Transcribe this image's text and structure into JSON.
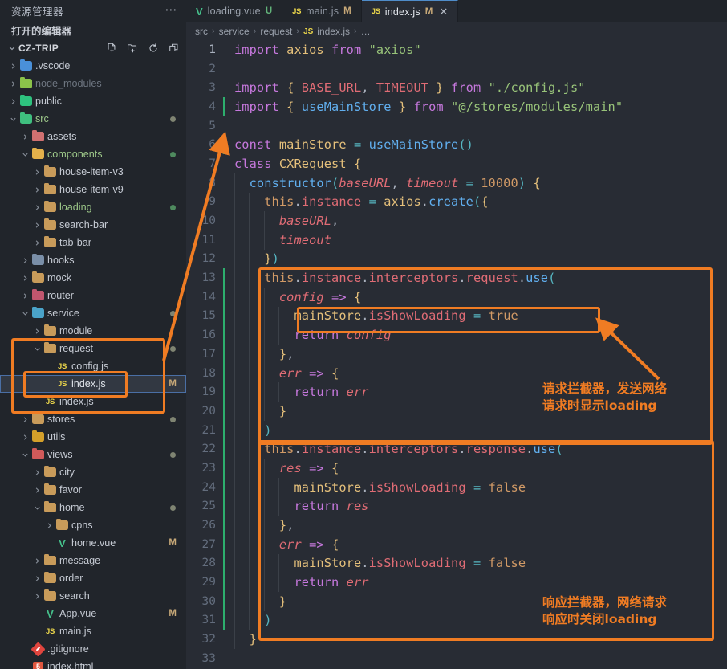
{
  "sidebar": {
    "title": "资源管理器",
    "more_icon": "ellipsis-icon",
    "open_editors_label": "打开的编辑器",
    "project_name": "CZ-TRIP",
    "header_actions": [
      {
        "name": "new-file-icon",
        "label": "新建文件"
      },
      {
        "name": "new-folder-icon",
        "label": "新建文件夹"
      },
      {
        "name": "refresh-icon",
        "label": "刷新"
      },
      {
        "name": "collapse-all-icon",
        "label": "全部折叠"
      }
    ],
    "items": [
      {
        "label": ".vscode",
        "indent": 0,
        "type": "folder",
        "chevron": "right",
        "color": "#4a90d9",
        "badge": "",
        "dot": ""
      },
      {
        "label": "node_modules",
        "indent": 0,
        "type": "folder",
        "chevron": "right",
        "color": "#8bc34a",
        "badge": "",
        "dot": "",
        "dim": true
      },
      {
        "label": "public",
        "indent": 0,
        "type": "folder",
        "chevron": "right",
        "color": "#2ec27e",
        "badge": "",
        "dot": ""
      },
      {
        "label": "src",
        "indent": 0,
        "type": "folder",
        "chevron": "down",
        "color": "#3fbf7f",
        "badge": "",
        "dot": "#7f8472",
        "active": true
      },
      {
        "label": "assets",
        "indent": 1,
        "type": "folder",
        "chevron": "right",
        "color": "#d07070",
        "badge": "",
        "dot": ""
      },
      {
        "label": "components",
        "indent": 1,
        "type": "folder",
        "chevron": "down",
        "color": "#e3b04b",
        "badge": "",
        "dot": "#4e8a5e",
        "active": true
      },
      {
        "label": "house-item-v3",
        "indent": 2,
        "type": "folder",
        "chevron": "right",
        "color": "#c89b5a",
        "badge": "",
        "dot": ""
      },
      {
        "label": "house-item-v9",
        "indent": 2,
        "type": "folder",
        "chevron": "right",
        "color": "#c89b5a",
        "badge": "",
        "dot": ""
      },
      {
        "label": "loading",
        "indent": 2,
        "type": "folder",
        "chevron": "right",
        "color": "#c89b5a",
        "badge": "",
        "dot": "#4e8a5e",
        "active": true
      },
      {
        "label": "search-bar",
        "indent": 2,
        "type": "folder",
        "chevron": "right",
        "color": "#c89b5a",
        "badge": "",
        "dot": ""
      },
      {
        "label": "tab-bar",
        "indent": 2,
        "type": "folder",
        "chevron": "right",
        "color": "#c89b5a",
        "badge": "",
        "dot": ""
      },
      {
        "label": "hooks",
        "indent": 1,
        "type": "folder",
        "chevron": "right",
        "color": "#7a8fa8",
        "badge": "",
        "dot": ""
      },
      {
        "label": "mock",
        "indent": 1,
        "type": "folder",
        "chevron": "right",
        "color": "#c89b5a",
        "badge": "",
        "dot": ""
      },
      {
        "label": "router",
        "indent": 1,
        "type": "folder",
        "chevron": "right",
        "color": "#c0566e",
        "badge": "",
        "dot": ""
      },
      {
        "label": "service",
        "indent": 1,
        "type": "folder",
        "chevron": "down",
        "color": "#4aa3c9",
        "badge": "",
        "dot": "#7f8472"
      },
      {
        "label": "module",
        "indent": 2,
        "type": "folder",
        "chevron": "right",
        "color": "#c89b5a",
        "badge": "",
        "dot": ""
      },
      {
        "label": "request",
        "indent": 2,
        "type": "folder",
        "chevron": "down",
        "color": "#c89b5a",
        "badge": "",
        "dot": "#7f8472"
      },
      {
        "label": "config.js",
        "indent": 3,
        "type": "js",
        "chevron": "none",
        "color": "",
        "badge": "",
        "dot": ""
      },
      {
        "label": "index.js",
        "indent": 3,
        "type": "js",
        "chevron": "none",
        "color": "",
        "badge": "M",
        "dot": "",
        "selected": true
      },
      {
        "label": "index.js",
        "indent": 2,
        "type": "js",
        "chevron": "none",
        "color": "",
        "badge": "",
        "dot": ""
      },
      {
        "label": "stores",
        "indent": 1,
        "type": "folder",
        "chevron": "right",
        "color": "#c89b5a",
        "badge": "",
        "dot": "#7f8472"
      },
      {
        "label": "utils",
        "indent": 1,
        "type": "folder",
        "chevron": "right",
        "color": "#d4a02a",
        "badge": "",
        "dot": ""
      },
      {
        "label": "views",
        "indent": 1,
        "type": "folder",
        "chevron": "down",
        "color": "#d05a5a",
        "badge": "",
        "dot": "#7f8472"
      },
      {
        "label": "city",
        "indent": 2,
        "type": "folder",
        "chevron": "right",
        "color": "#c89b5a",
        "badge": "",
        "dot": ""
      },
      {
        "label": "favor",
        "indent": 2,
        "type": "folder",
        "chevron": "right",
        "color": "#c89b5a",
        "badge": "",
        "dot": ""
      },
      {
        "label": "home",
        "indent": 2,
        "type": "folder",
        "chevron": "down",
        "color": "#c89b5a",
        "badge": "",
        "dot": "#7f8472"
      },
      {
        "label": "cpns",
        "indent": 3,
        "type": "folder",
        "chevron": "right",
        "color": "#c89b5a",
        "badge": "",
        "dot": ""
      },
      {
        "label": "home.vue",
        "indent": 3,
        "type": "vue",
        "chevron": "none",
        "color": "",
        "badge": "M",
        "dot": ""
      },
      {
        "label": "message",
        "indent": 2,
        "type": "folder",
        "chevron": "right",
        "color": "#c89b5a",
        "badge": "",
        "dot": ""
      },
      {
        "label": "order",
        "indent": 2,
        "type": "folder",
        "chevron": "right",
        "color": "#c89b5a",
        "badge": "",
        "dot": ""
      },
      {
        "label": "search",
        "indent": 2,
        "type": "folder",
        "chevron": "right",
        "color": "#c89b5a",
        "badge": "",
        "dot": ""
      },
      {
        "label": "App.vue",
        "indent": 2,
        "type": "vue",
        "chevron": "none",
        "color": "",
        "badge": "M",
        "dot": ""
      },
      {
        "label": "main.js",
        "indent": 2,
        "type": "js",
        "chevron": "none",
        "color": "",
        "badge": "",
        "dot": ""
      },
      {
        "label": ".gitignore",
        "indent": 1,
        "type": "git",
        "chevron": "none",
        "color": "",
        "badge": "",
        "dot": ""
      },
      {
        "label": "index.html",
        "indent": 1,
        "type": "html",
        "chevron": "none",
        "color": "",
        "badge": "",
        "dot": ""
      }
    ]
  },
  "tabs": [
    {
      "name": "loading.vue",
      "icon": "vue-icon",
      "status": "U",
      "active": false,
      "closable": false
    },
    {
      "name": "main.js",
      "icon": "js-icon",
      "status": "M",
      "active": false,
      "closable": false
    },
    {
      "name": "index.js",
      "icon": "js-icon",
      "status": "M",
      "active": true,
      "closable": true,
      "close_glyph": "✕"
    }
  ],
  "breadcrumb": {
    "parts": [
      "src",
      "service",
      "request"
    ],
    "file_icon": "js-icon",
    "file": "index.js",
    "tail": "…",
    "separator": "›"
  },
  "code": {
    "lines": [
      {
        "n": "1",
        "git": "",
        "text": "import axios from \"axios\""
      },
      {
        "n": "2",
        "git": "",
        "text": ""
      },
      {
        "n": "3",
        "git": "",
        "text": "import { BASE_URL, TIMEOUT } from \"./config.js\""
      },
      {
        "n": "4",
        "git": "#2dae6d",
        "text": "import { useMainStore } from \"@/stores/modules/main\""
      },
      {
        "n": "5",
        "git": "",
        "text": ""
      },
      {
        "n": "6",
        "git": "#2dae6d",
        "text": "const mainStore = useMainStore()"
      },
      {
        "n": "7",
        "git": "",
        "text": "class CXRequest {"
      },
      {
        "n": "8",
        "git": "",
        "text": "  constructor(baseURL, timeout = 10000) {"
      },
      {
        "n": "9",
        "git": "",
        "text": "    this.instance = axios.create({"
      },
      {
        "n": "10",
        "git": "",
        "text": "      baseURL,"
      },
      {
        "n": "11",
        "git": "",
        "text": "      timeout"
      },
      {
        "n": "12",
        "git": "",
        "text": "    })"
      },
      {
        "n": "13",
        "git": "#2dae6d",
        "text": "    this.instance.interceptors.request.use("
      },
      {
        "n": "14",
        "git": "#2dae6d",
        "text": "      config => {"
      },
      {
        "n": "15",
        "git": "#2dae6d",
        "text": "        mainStore.isShowLoading = true"
      },
      {
        "n": "16",
        "git": "#2dae6d",
        "text": "        return config"
      },
      {
        "n": "17",
        "git": "#2dae6d",
        "text": "      },"
      },
      {
        "n": "18",
        "git": "#2dae6d",
        "text": "      err => {"
      },
      {
        "n": "19",
        "git": "#2dae6d",
        "text": "        return err"
      },
      {
        "n": "20",
        "git": "#2dae6d",
        "text": "      }"
      },
      {
        "n": "21",
        "git": "#2dae6d",
        "text": "    )"
      },
      {
        "n": "22",
        "git": "#2dae6d",
        "text": "    this.instance.interceptors.response.use("
      },
      {
        "n": "23",
        "git": "#2dae6d",
        "text": "      res => {"
      },
      {
        "n": "24",
        "git": "#2dae6d",
        "text": "        mainStore.isShowLoading = false"
      },
      {
        "n": "25",
        "git": "#2dae6d",
        "text": "        return res"
      },
      {
        "n": "26",
        "git": "#2dae6d",
        "text": "      },"
      },
      {
        "n": "27",
        "git": "#2dae6d",
        "text": "      err => {"
      },
      {
        "n": "28",
        "git": "#2dae6d",
        "text": "        mainStore.isShowLoading = false"
      },
      {
        "n": "29",
        "git": "#2dae6d",
        "text": "        return err"
      },
      {
        "n": "30",
        "git": "#2dae6d",
        "text": "      }"
      },
      {
        "n": "31",
        "git": "#2dae6d",
        "text": "    )"
      },
      {
        "n": "32",
        "git": "",
        "text": "  }"
      },
      {
        "n": "33",
        "git": "",
        "text": ""
      }
    ]
  },
  "annotations": {
    "accent_color": "#f07c23",
    "request_note": "请求拦截器，发送网络\n请求时显示loading",
    "response_note": "响应拦截器，网络请求\n响应时关闭loading"
  }
}
